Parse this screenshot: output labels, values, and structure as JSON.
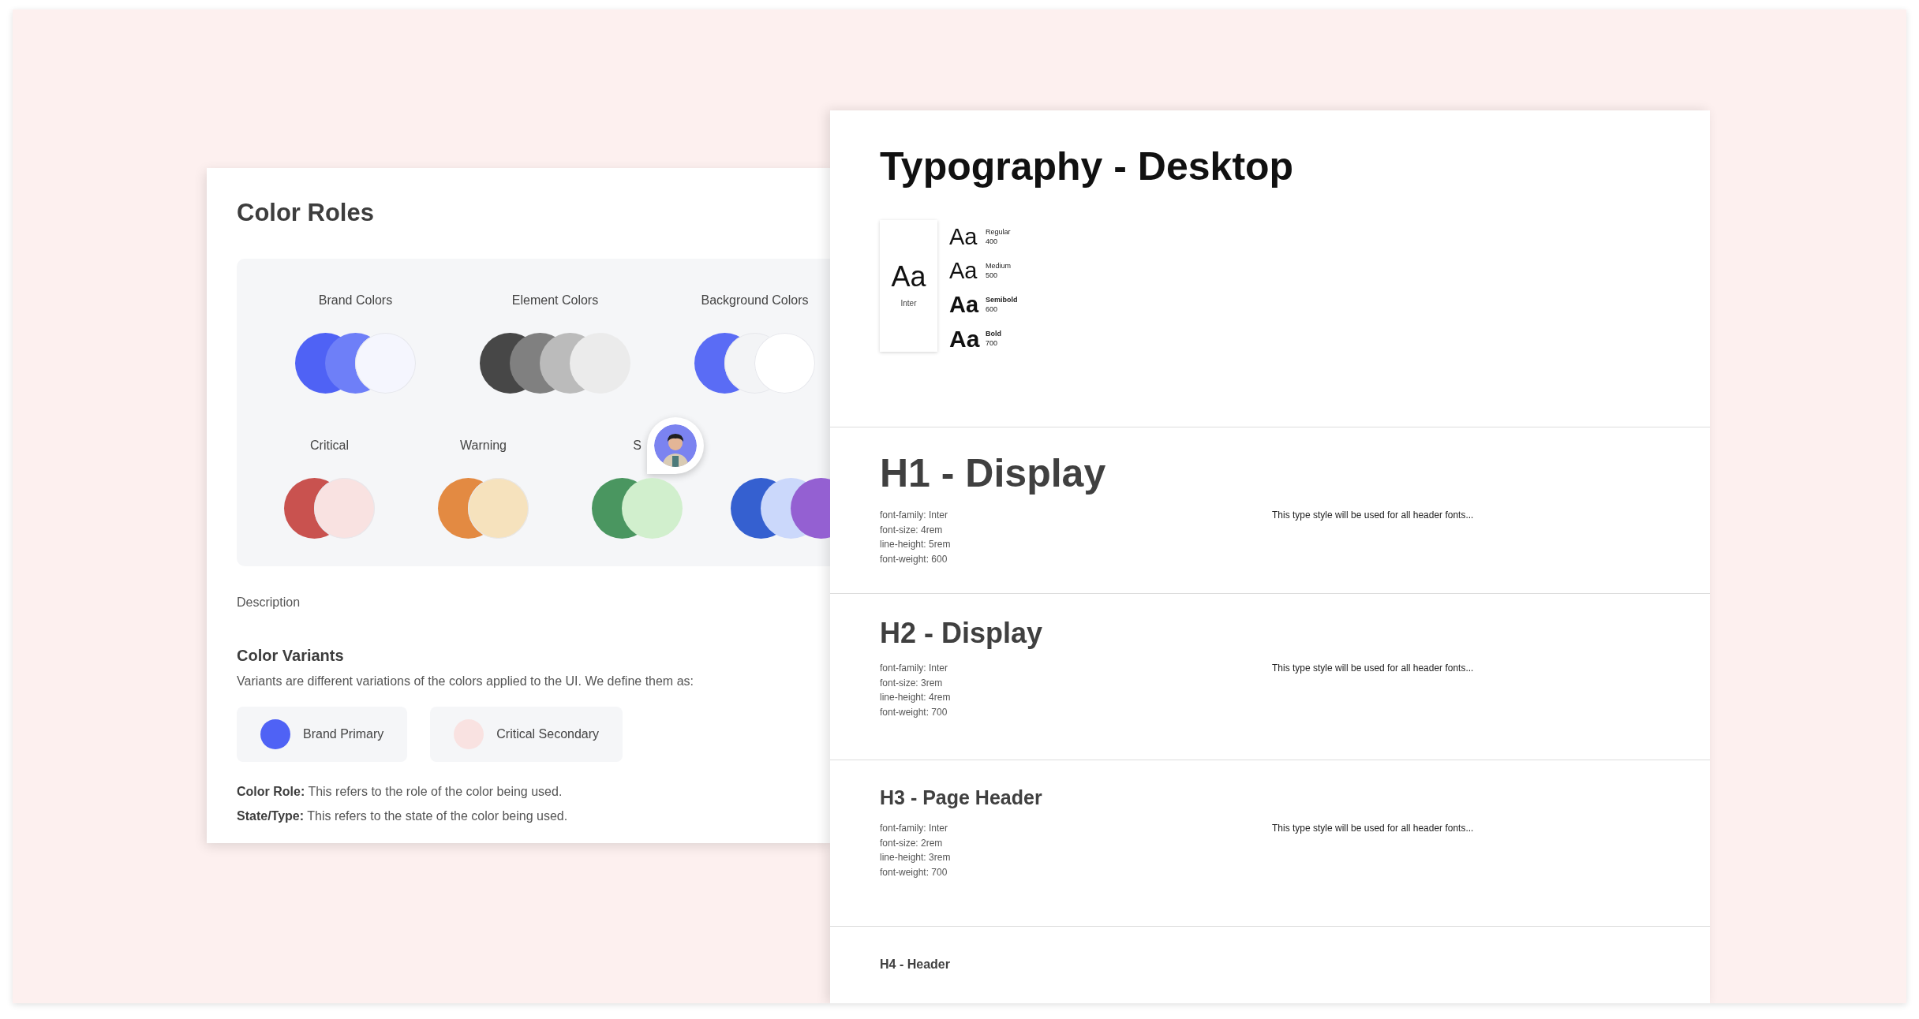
{
  "color_roles": {
    "title": "Color Roles",
    "groups": [
      {
        "label": "Brand Colors",
        "swatches": [
          {
            "color": "#4f62f5"
          },
          {
            "color": "#6e7ff8"
          },
          {
            "color": "#f5f6fe"
          }
        ]
      },
      {
        "label": "Element Colors",
        "swatches": [
          {
            "color": "#474747"
          },
          {
            "color": "#808080"
          },
          {
            "color": "#bbbbbb"
          },
          {
            "color": "#ebebeb"
          }
        ]
      },
      {
        "label": "Background Colors",
        "swatches": [
          {
            "color": "#5a6cf5"
          },
          {
            "color": "#f3f4f6"
          },
          {
            "color": "#ffffff"
          }
        ]
      },
      {
        "label": "Critical",
        "swatches": [
          {
            "color": "#c9524f"
          },
          {
            "color": "#f9e2e1"
          }
        ]
      },
      {
        "label": "Warning",
        "swatches": [
          {
            "color": "#e38a42"
          },
          {
            "color": "#f6e2bd"
          }
        ]
      },
      {
        "label": "S",
        "swatches": [
          {
            "color": "#4a9660"
          },
          {
            "color": "#d1efcd"
          }
        ]
      },
      {
        "swatches": [
          {
            "color": "#3560d0"
          },
          {
            "color": "#cbd8fb"
          },
          {
            "color": "#9460d2"
          }
        ]
      }
    ],
    "description": "Description",
    "variants": {
      "title": "Color Variants",
      "text": "Variants are different variations of the colors applied to the UI. We define them as:",
      "chips": [
        {
          "label": "Brand Primary",
          "color": "#4f62f5"
        },
        {
          "label": "Critical Secondary",
          "color": "#f9e2e1"
        }
      ]
    },
    "definitions": [
      "**Color Role:** This refers to the role of the color being used.",
      "**State/Type:** This refers to the state of the color being used."
    ]
  },
  "typography": {
    "title": "Typography - Desktop",
    "specimen": {
      "sample": "Aa",
      "family": "Inter"
    },
    "weights": [
      {
        "sample": "Aa",
        "name": "Regular",
        "value": "400"
      },
      {
        "sample": "Aa",
        "name": "Medium",
        "value": "500"
      },
      {
        "sample": "Aa",
        "name": "Semibold",
        "value": "600"
      },
      {
        "sample": "Aa",
        "name": "Bold",
        "value": "700"
      }
    ],
    "styles": [
      {
        "title": "H1 - Display",
        "specs": [
          "font-family: Inter",
          "font-size: 4rem",
          "line-height: 5rem",
          "font-weight: 600"
        ],
        "description": "This type style will be used for all header fonts..."
      },
      {
        "title": "H2 - Display",
        "specs": [
          "font-family: Inter",
          "font-size: 3rem",
          "line-height: 4rem",
          "font-weight: 700"
        ],
        "description": "This type style will be used for all header fonts..."
      },
      {
        "title": "H3 - Page Header",
        "specs": [
          "font-family: Inter",
          "font-size: 2rem",
          "line-height: 3rem",
          "font-weight: 700"
        ],
        "description": "This type style will be used for all header fonts..."
      },
      {
        "title": "H4 - Header"
      }
    ]
  }
}
